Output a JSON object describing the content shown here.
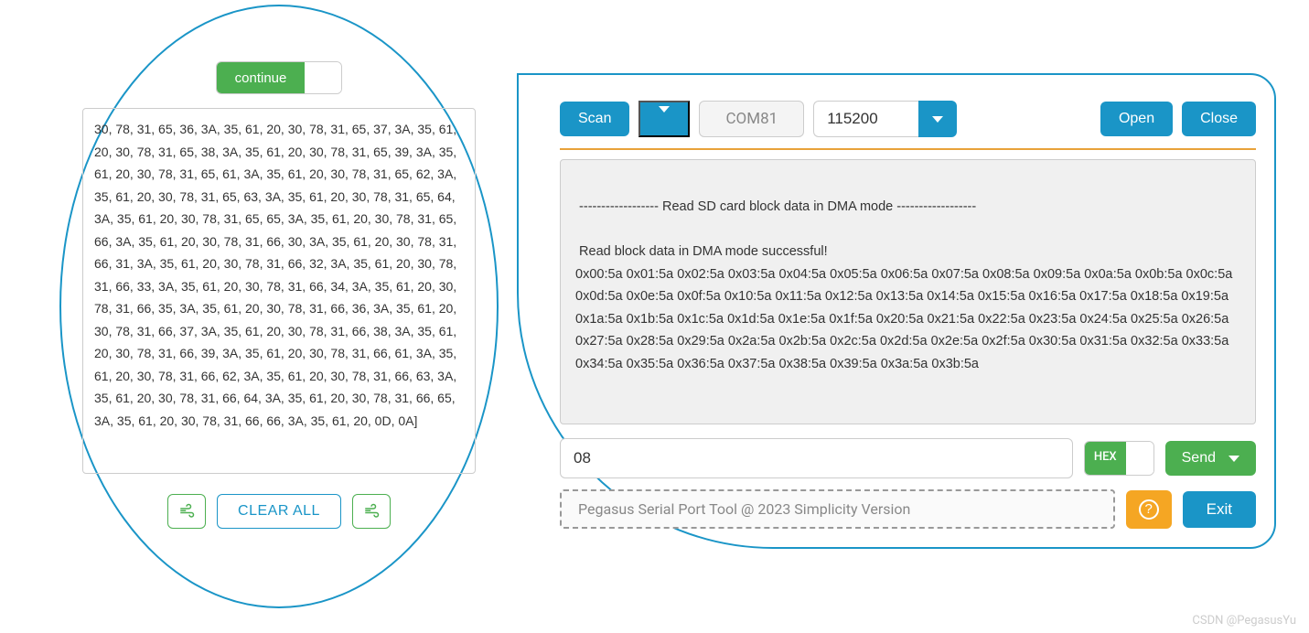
{
  "left": {
    "continue_label": "continue",
    "data_text": "30, 78, 31, 65, 36, 3A, 35, 61, 20, 30, 78, 31, 65, 37, 3A, 35, 61, 20, 30, 78, 31, 65, 38, 3A, 35, 61, 20, 30, 78, 31, 65, 39, 3A, 35, 61, 20, 30, 78, 31, 65, 61, 3A, 35, 61, 20, 30, 78, 31, 65, 62, 3A, 35, 61, 20, 30, 78, 31, 65, 63, 3A, 35, 61, 20, 30, 78, 31, 65, 64, 3A, 35, 61, 20, 30, 78, 31, 65, 65, 3A, 35, 61, 20, 30, 78, 31, 65, 66, 3A, 35, 61, 20, 30, 78, 31, 66, 30, 3A, 35, 61, 20, 30, 78, 31, 66, 31, 3A, 35, 61, 20, 30, 78, 31, 66, 32, 3A, 35, 61, 20, 30, 78, 31, 66, 33, 3A, 35, 61, 20, 30, 78, 31, 66, 34, 3A, 35, 61, 20, 30, 78, 31, 66, 35, 3A, 35, 61, 20, 30, 78, 31, 66, 36, 3A, 35, 61, 20, 30, 78, 31, 66, 37, 3A, 35, 61, 20, 30, 78, 31, 66, 38, 3A, 35, 61, 20, 30, 78, 31, 66, 39, 3A, 35, 61, 20, 30, 78, 31, 66, 61, 3A, 35, 61, 20, 30, 78, 31, 66, 62, 3A, 35, 61, 20, 30, 78, 31, 66, 63, 3A, 35, 61, 20, 30, 78, 31, 66, 64, 3A, 35, 61, 20, 30, 78, 31, 66, 65, 3A, 35, 61, 20, 30, 78, 31, 66, 66, 3A, 35, 61, 20, 0D, 0A]",
    "clear_label": "CLEAR ALL"
  },
  "toolbar": {
    "scan_label": "Scan",
    "port_label": "COM81",
    "baud_value": "115200",
    "open_label": "Open",
    "close_label": "Close"
  },
  "terminal": {
    "content": "\n ------------------ Read SD card block data in DMA mode ------------------\n\n Read block data in DMA mode successful!\n0x00:5a 0x01:5a 0x02:5a 0x03:5a 0x04:5a 0x05:5a 0x06:5a 0x07:5a 0x08:5a 0x09:5a 0x0a:5a 0x0b:5a 0x0c:5a 0x0d:5a 0x0e:5a 0x0f:5a 0x10:5a 0x11:5a 0x12:5a 0x13:5a 0x14:5a 0x15:5a 0x16:5a 0x17:5a 0x18:5a 0x19:5a 0x1a:5a 0x1b:5a 0x1c:5a 0x1d:5a 0x1e:5a 0x1f:5a 0x20:5a 0x21:5a 0x22:5a 0x23:5a 0x24:5a 0x25:5a 0x26:5a 0x27:5a 0x28:5a 0x29:5a 0x2a:5a 0x2b:5a 0x2c:5a 0x2d:5a 0x2e:5a 0x2f:5a 0x30:5a 0x31:5a 0x32:5a 0x33:5a 0x34:5a 0x35:5a 0x36:5a 0x37:5a 0x38:5a 0x39:5a 0x3a:5a 0x3b:5a"
  },
  "input": {
    "value": "08",
    "hex_label": "HEX",
    "send_label": "Send"
  },
  "footer": {
    "label": "Pegasus Serial Port Tool @ 2023 Simplicity Version",
    "exit_label": "Exit"
  },
  "watermark": "CSDN @PegasusYu"
}
